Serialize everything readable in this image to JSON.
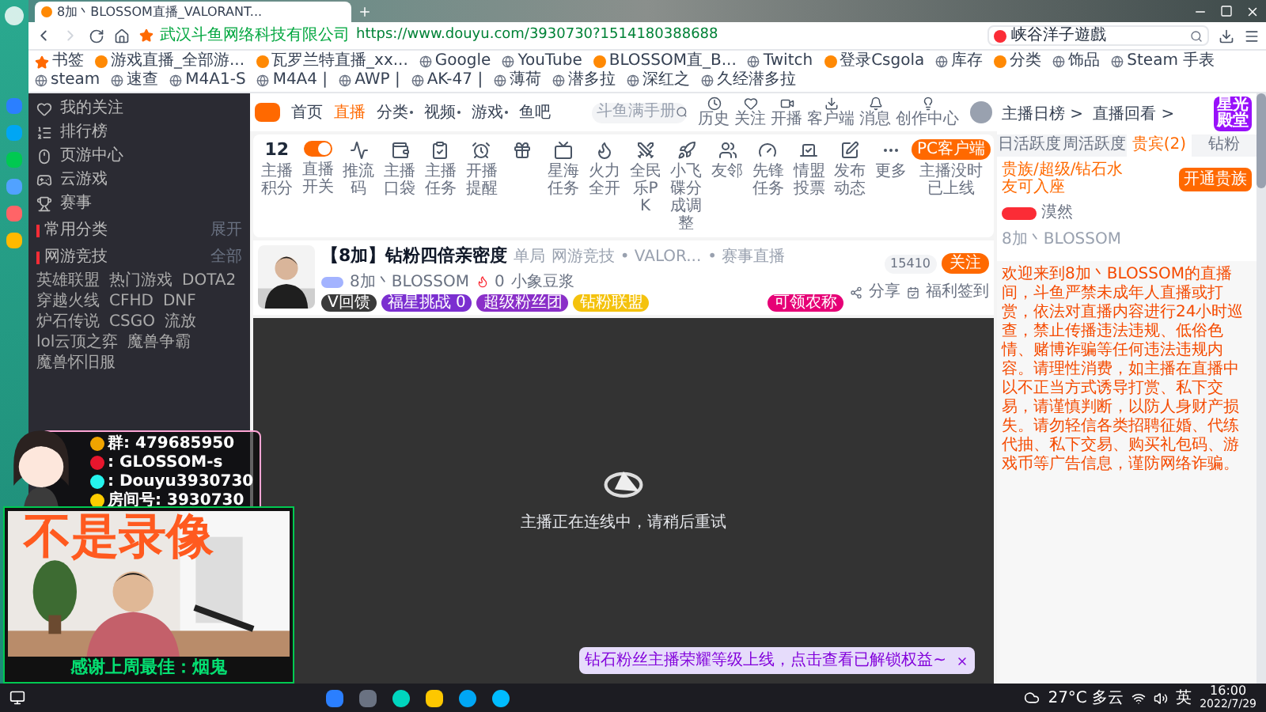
{
  "browser": {
    "tab": {
      "title": "8加丶BLOSSOM直播_VALORANT..."
    },
    "site_owner": "武汉斗鱼网络科技有限公司",
    "url": "https://www.douyu.com/3930730?1514180388688",
    "search": {
      "value": "峡谷洋子遊戲"
    },
    "bookmarks": [
      {
        "label": "书签",
        "kind": "star"
      },
      {
        "label": "游戏直播_全部游...",
        "kind": "site"
      },
      {
        "label": "瓦罗兰特直播_xx...",
        "kind": "site"
      },
      {
        "label": "Google",
        "kind": "globe"
      },
      {
        "label": "YouTube",
        "kind": "globe"
      },
      {
        "label": "BLOSSOM直_B...",
        "kind": "site"
      },
      {
        "label": "Twitch",
        "kind": "globe"
      },
      {
        "label": "登录Csgola",
        "kind": "site"
      },
      {
        "label": "库存",
        "kind": "globe"
      },
      {
        "label": "分类",
        "kind": "site"
      },
      {
        "label": "饰品",
        "kind": "globe"
      },
      {
        "label": "Steam 手表",
        "kind": "globe"
      },
      {
        "label": "steam",
        "kind": "globe"
      },
      {
        "label": "速查",
        "kind": "globe"
      },
      {
        "label": "M4A1-S",
        "kind": "globe"
      },
      {
        "label": "M4A4 |",
        "kind": "globe"
      },
      {
        "label": "AWP |",
        "kind": "globe"
      },
      {
        "label": "AK-47 |",
        "kind": "globe"
      },
      {
        "label": "薄荷",
        "kind": "globe"
      },
      {
        "label": "潜多拉",
        "kind": "globe"
      },
      {
        "label": "深红之",
        "kind": "globe"
      },
      {
        "label": "久经潜多拉",
        "kind": "globe"
      }
    ]
  },
  "nav": {
    "items": [
      {
        "label": "首页",
        "selected": false,
        "dropdown": false
      },
      {
        "label": "直播",
        "selected": true,
        "dropdown": false
      },
      {
        "label": "分类",
        "selected": false,
        "dropdown": true
      },
      {
        "label": "视频",
        "selected": false,
        "dropdown": true
      },
      {
        "label": "游戏",
        "selected": false,
        "dropdown": true
      },
      {
        "label": "鱼吧",
        "selected": false,
        "dropdown": false
      }
    ],
    "search": {
      "placeholder": "斗鱼满手册"
    },
    "actions": [
      {
        "label": "历史",
        "kind": "history"
      },
      {
        "label": "关注",
        "kind": "heart"
      },
      {
        "label": "开播",
        "kind": "camera"
      },
      {
        "label": "客户端",
        "kind": "download"
      },
      {
        "label": "消息",
        "kind": "bell"
      },
      {
        "label": "创作中心",
        "kind": "bulb"
      }
    ]
  },
  "sidebar": {
    "items": [
      {
        "label": "我的关注",
        "kind": "heart"
      },
      {
        "label": "排行榜",
        "kind": "rank"
      },
      {
        "label": "页游中心",
        "kind": "mouse"
      },
      {
        "label": "云游戏",
        "kind": "gamepad"
      },
      {
        "label": "赛事",
        "kind": "trophy"
      }
    ],
    "sections": [
      {
        "title": "常用分类",
        "action": "展开"
      },
      {
        "title": "网游竞技",
        "action": "全部"
      }
    ],
    "categories": [
      "英雄联盟",
      "热门游戏",
      "DOTA2",
      "穿越火线",
      "CFHD",
      "DNF",
      "炉石传说",
      "CSGO",
      "流放",
      "lol云顶之弈",
      "魔兽争霸",
      "魔兽怀旧服"
    ]
  },
  "toolbar": {
    "score": "12",
    "items": [
      {
        "label": "主播积分",
        "kind": "score"
      },
      {
        "label": "直播开关",
        "kind": "toggle",
        "on": true
      },
      {
        "label": "推流码",
        "kind": "wave"
      },
      {
        "label": "主播口袋",
        "kind": "pocket"
      },
      {
        "label": "主播任务",
        "kind": "task"
      },
      {
        "label": "开播提醒",
        "kind": "alarm"
      },
      {
        "kind": "gift"
      },
      {
        "label": "星海任务",
        "kind": "ad"
      },
      {
        "label": "火力全开",
        "kind": "flame"
      },
      {
        "label": "全民乐PK",
        "kind": "pk"
      },
      {
        "label": "小飞碟分成调整",
        "kind": "ufo"
      },
      {
        "label": "友邻",
        "kind": "users"
      },
      {
        "label": "先锋任务",
        "kind": "gauge"
      },
      {
        "label": "情盟投票",
        "kind": "vote"
      },
      {
        "label": "发布动态",
        "kind": "edit"
      },
      {
        "label": "更多",
        "kind": "more"
      }
    ],
    "client_button": "PC客户端",
    "client_note": "主播没时已上线"
  },
  "streamer": {
    "title": "【8加】钻粉四倍亲密度",
    "tags": [
      "单局",
      "网游竞技 • VALOR...",
      "• 赛事直播"
    ],
    "name": "8加丶BLOSSOM",
    "heat": "0",
    "partner": "小象豆浆",
    "pills": [
      {
        "label": "V回馈",
        "color": "#3a3a3a"
      },
      {
        "label": "福星挑战 0",
        "color": "#7b2fd0"
      },
      {
        "label": "超级粉丝团",
        "color": "#8a2fc8"
      },
      {
        "label": "钻粉联盟",
        "color": "#f4c20d"
      }
    ],
    "promo": "可领农称",
    "followers": "15410",
    "follow_button": "关注",
    "share": "分享",
    "signin": "福利签到"
  },
  "video": {
    "message": "主播正在连线中，请稍后重试",
    "notice": "钻石粉丝主播荣耀等级上线，点击查看已解锁权益~"
  },
  "panel": {
    "links": [
      "主播日榜 >",
      "直播回看 >"
    ],
    "tabs": [
      {
        "label": "日活跃度",
        "selected": false
      },
      {
        "label": "周活跃度",
        "selected": false
      },
      {
        "label": "贵宾(2)",
        "selected": true
      },
      {
        "label": "钻粉",
        "selected": false
      }
    ],
    "hint": "贵族/超级/钻石水友可入座",
    "open_button": "开通贵族",
    "guest": "漠然",
    "owner": "8加丶BLOSSOM",
    "badge": "星光殿堂",
    "notice": "欢迎来到8加丶BLOSSOM的直播间，斗鱼严禁未成年人直播或打赏，依法对直播内容进行24小时巡查，禁止传播违法违规、低俗色情、赌博诈骗等任何违法违规内容。请理性消费，如主播在直播中以不正当方式诱导打赏、私下交易，请谨慎判断，以防人身财产损失。请勿轻信各类招聘征婚、代练代抽、私下交易、购买礼包码、游戏币等广告信息，谨防网络诈骗。"
  },
  "overlay": {
    "socials": [
      {
        "kind": "qq",
        "text": "群: 479685950"
      },
      {
        "kind": "weibo",
        "text": ": GLOSSOM-s"
      },
      {
        "kind": "tiktok",
        "text": ": Douyu3930730"
      },
      {
        "kind": "room",
        "text": "房间号: 3930730"
      }
    ],
    "webcam_caption": "不是录像",
    "thanks": "感谢上周最佳：烟鬼"
  },
  "taskbar": {
    "weather": "27°C 多云",
    "ime": "英",
    "time": "16:00",
    "date": "2022/7/29"
  }
}
